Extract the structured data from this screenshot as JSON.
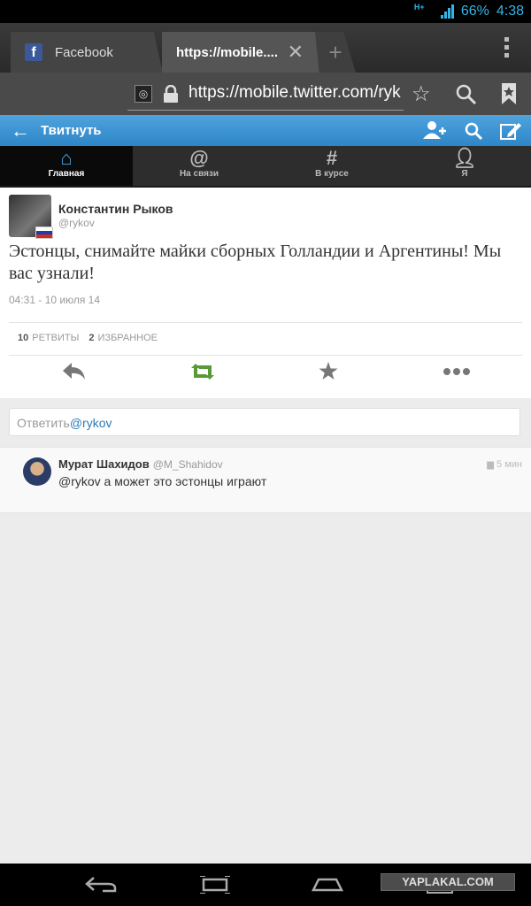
{
  "status_bar": {
    "network": "H+",
    "battery": "66%",
    "time": "4:38"
  },
  "browser": {
    "tabs": [
      {
        "label": "Facebook",
        "icon": "facebook-icon"
      },
      {
        "label": "https://mobile....",
        "active": true
      }
    ],
    "url": "https://mobile.twitter.com/ryk"
  },
  "twitter_header": {
    "title": "Твитнуть"
  },
  "twitter_nav": [
    {
      "label": "Главная",
      "active": true,
      "icon": "home-icon"
    },
    {
      "label": "На связи",
      "icon": "at-icon"
    },
    {
      "label": "В курсе",
      "icon": "hash-icon"
    },
    {
      "label": "Я",
      "icon": "user-icon"
    }
  ],
  "tweet": {
    "name": "Константин Рыков",
    "handle": "@rykov",
    "text": "Эстонцы, снимайте майки сборных Голландии и Аргентины! Мы вас узнали!",
    "timestamp": "04:31 - 10 июля 14",
    "retweets": "10",
    "retweets_label": "РЕТВИТЫ",
    "favorites": "2",
    "favorites_label": "ИЗБРАННОЕ"
  },
  "reply_box": {
    "placeholder": "Ответить",
    "mention": "@rykov"
  },
  "reply": {
    "name": "Мурат Шахидов",
    "handle": "@M_Shahidov",
    "time": "5 мин",
    "text": "@rykov а может это эстонцы играют"
  },
  "watermark": "YAPLAKAL.COM"
}
